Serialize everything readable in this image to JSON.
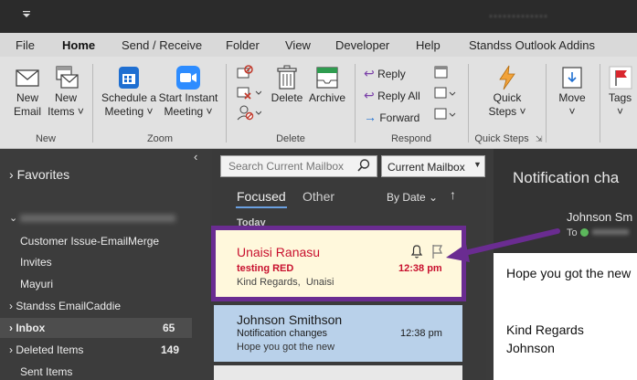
{
  "menu": {
    "tabs": [
      "File",
      "Home",
      "Send / Receive",
      "Folder",
      "View",
      "Developer",
      "Help",
      "Standss Outlook Addins"
    ]
  },
  "ribbon": {
    "new_email": [
      "New",
      "Email"
    ],
    "new_items": [
      "New",
      "Items ˅"
    ],
    "schedule_meeting": [
      "Schedule a",
      "Meeting ˅"
    ],
    "start_instant_meeting": [
      "Start Instant",
      "Meeting ˅"
    ],
    "delete": "Delete",
    "archive": "Archive",
    "reply": "Reply",
    "reply_all": "Reply All",
    "forward": "Forward",
    "quick_steps": [
      "Quick",
      "Steps ˅"
    ],
    "move": [
      "Move",
      "˅"
    ],
    "tags": [
      "Tags",
      "˅"
    ],
    "groups": {
      "new": "New",
      "zoom": "Zoom",
      "delete": "Delete",
      "respond": "Respond",
      "quick_steps": "Quick Steps"
    }
  },
  "folders": {
    "favorites": "Favorites",
    "items": [
      {
        "label": "Customer Issue-EmailMerge",
        "count": ""
      },
      {
        "label": "Invites",
        "count": ""
      },
      {
        "label": "Mayuri",
        "count": ""
      },
      {
        "label": "Standss EmailCaddie",
        "count": ""
      },
      {
        "label": "Inbox",
        "count": "65"
      },
      {
        "label": "Deleted Items",
        "count": "149"
      },
      {
        "label": "Sent Items",
        "count": ""
      }
    ]
  },
  "search": {
    "placeholder": "Search Current Mailbox",
    "scope": "Current Mailbox"
  },
  "list": {
    "focused_tab": "Focused",
    "other_tab": "Other",
    "sort": "By Date",
    "group_today": "Today",
    "messages": [
      {
        "sender": "Unaisi Ranasu",
        "subject": "testing RED",
        "time": "12:38 pm",
        "preview": "Kind Regards,  Unaisi"
      },
      {
        "sender": "Johnson Smithson",
        "subject": "Notification changes",
        "time": "12:38 pm",
        "preview": "Hope you got the new"
      }
    ]
  },
  "reading": {
    "subject": "Notification cha",
    "from": "Johnson Sm",
    "to_label": "To",
    "body_lines": [
      "Hope you got the new",
      "",
      "Kind Regards",
      "Johnson"
    ]
  },
  "colors": {
    "highlight_border": "#6a2c91",
    "arrow": "#6a2c91",
    "red_text": "#c8102e",
    "selected_row": "#b9d1ea",
    "highlight_row": "#fff8dc"
  }
}
